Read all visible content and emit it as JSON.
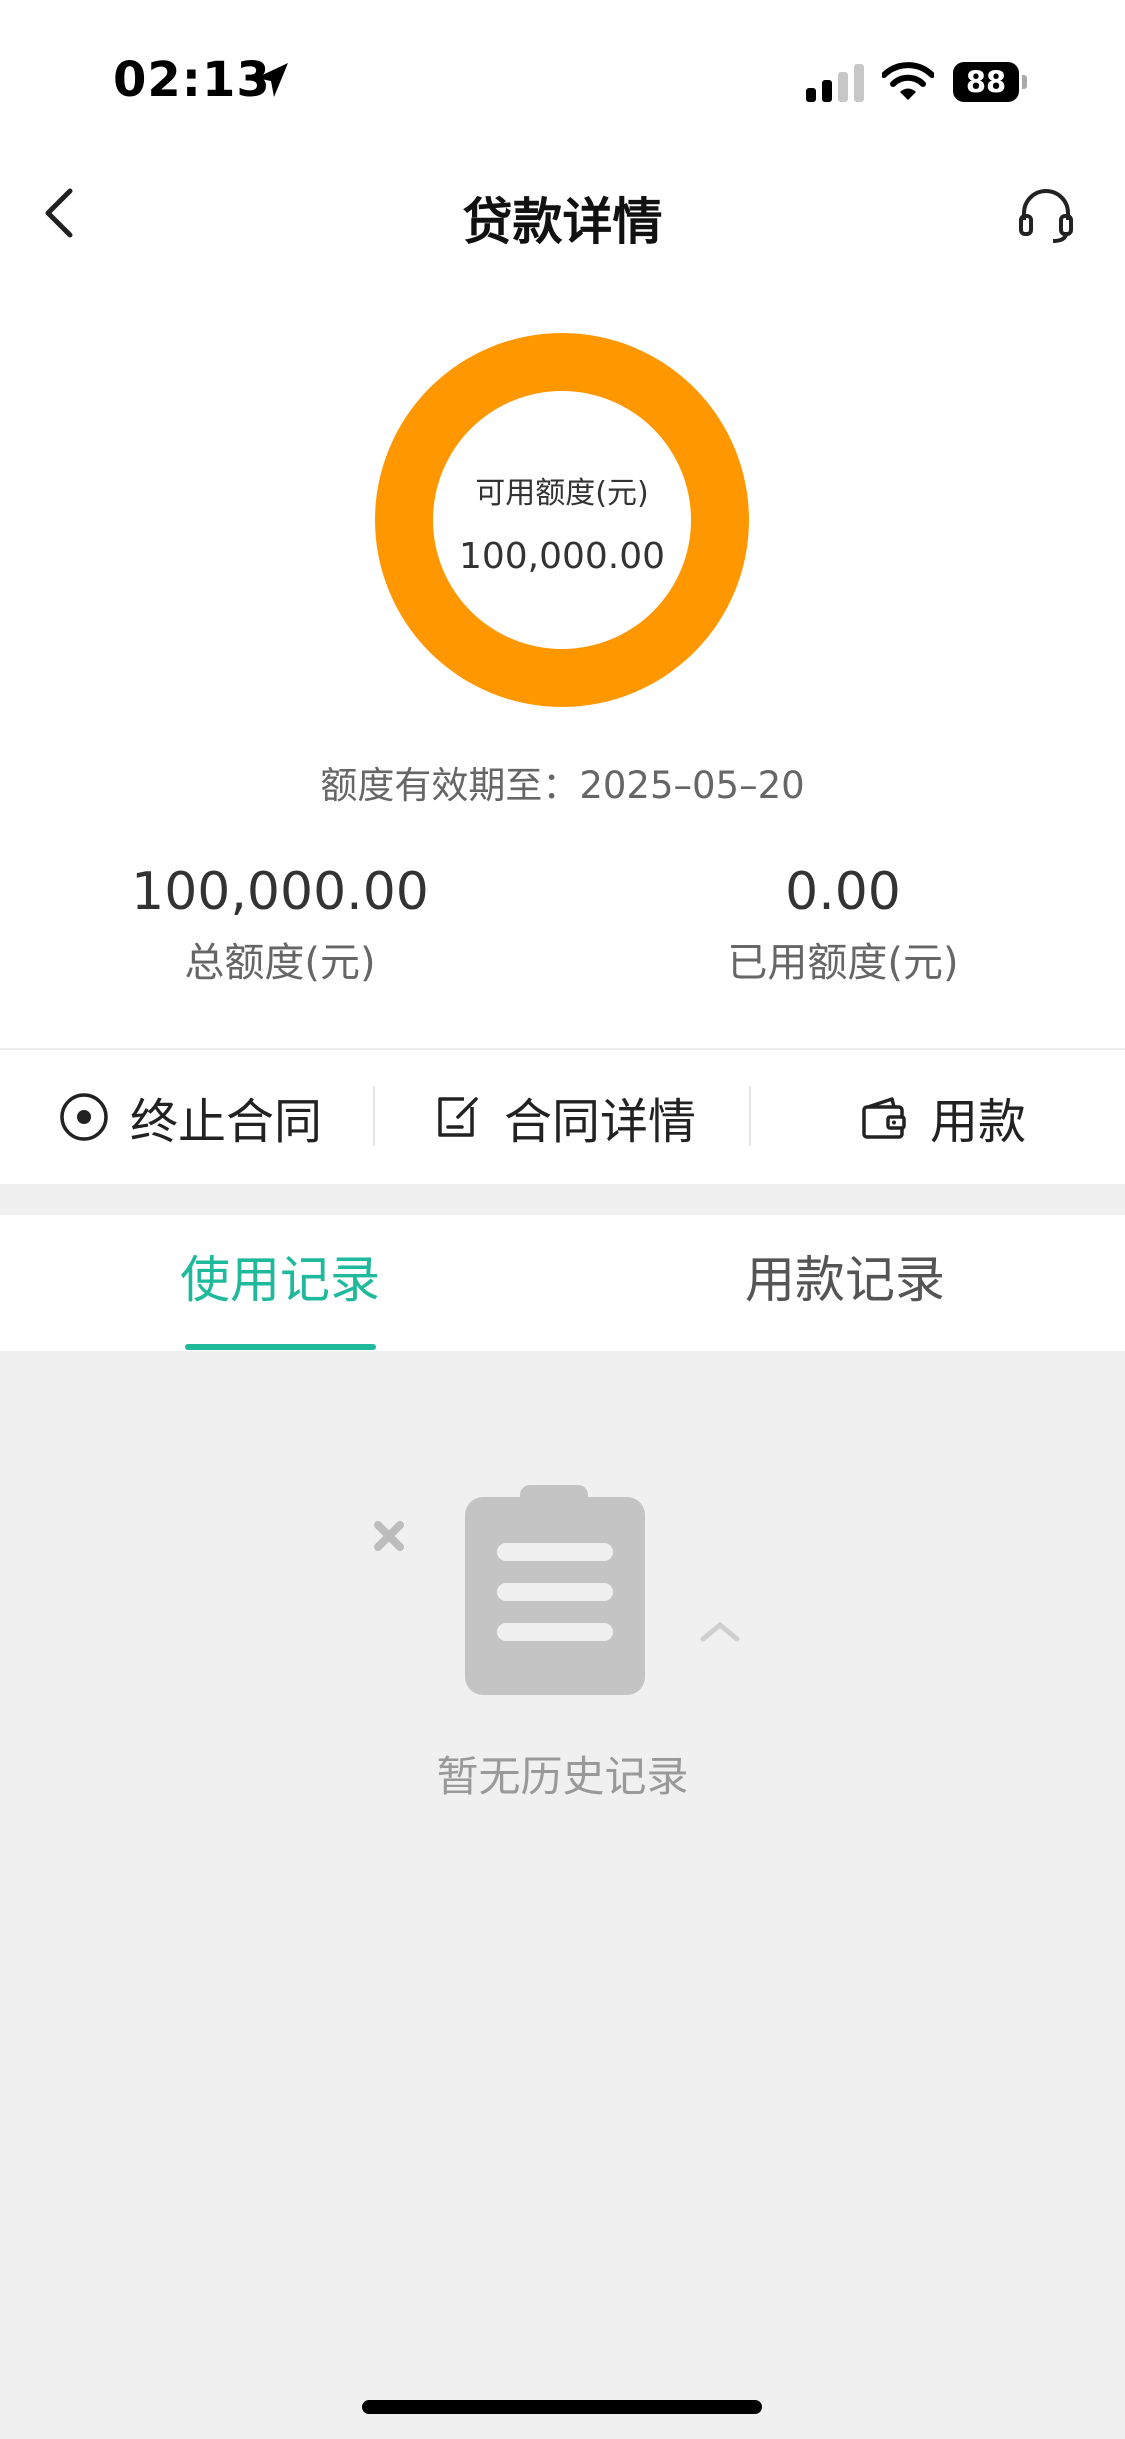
{
  "status_bar": {
    "time": "02:13",
    "battery": "88",
    "icons": [
      "location-arrow-icon",
      "signal-icon",
      "wifi-icon",
      "battery-icon"
    ]
  },
  "nav": {
    "title": "贷款详情",
    "back_icon": "chevron-left-icon",
    "service_icon": "headset-icon"
  },
  "credit": {
    "available_label": "可用额度(元)",
    "available_value": "100,000.00",
    "available_fraction": 1.0,
    "ring_color": "#ff9800",
    "validity_label": "额度有效期至：",
    "validity_date": "2025–05–20",
    "total_value": "100,000.00",
    "total_label": "总额度(元)",
    "used_value": "0.00",
    "used_label": "已用额度(元)"
  },
  "actions": [
    {
      "label": "终止合同",
      "icon": "stop-circle-icon"
    },
    {
      "label": "合同详情",
      "icon": "edit-document-icon"
    },
    {
      "label": "用款",
      "icon": "wallet-icon"
    }
  ],
  "tabs": [
    {
      "label": "使用记录",
      "active": true
    },
    {
      "label": "用款记录",
      "active": false
    }
  ],
  "accent_color": "#1fb99b",
  "empty_state": {
    "text": "暂无历史记录",
    "icon": "clipboard-empty-icon"
  }
}
